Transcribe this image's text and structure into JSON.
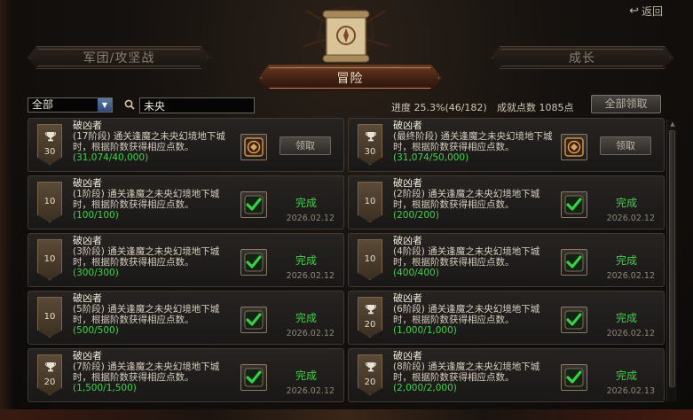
{
  "header": {
    "return_label": "返回",
    "tabs": [
      {
        "label": "军团/攻坚战"
      },
      {
        "label": "冒险"
      },
      {
        "label": "成长"
      }
    ]
  },
  "filter": {
    "selected": "全部",
    "search_value": "未央"
  },
  "summary": {
    "progress": "进度 25.3%(46/182)",
    "points": "成就点数 1085点",
    "claim_all_label": "全部领取"
  },
  "achievements": [
    {
      "title": "破凶者",
      "desc": "(17阶段) 通关逢魔之未央幻境地下城时，根据阶数获得相应点数。",
      "progress": "(31,074/40,000)",
      "points": "30",
      "cup": true,
      "status": "claim",
      "button": "领取"
    },
    {
      "title": "破凶者",
      "desc": "(最终阶段) 通关逢魔之未央幻境地下城时，根据阶数获得相应点数。",
      "progress": "(31,074/50,000)",
      "points": "30",
      "cup": true,
      "status": "claim",
      "button": "领取"
    },
    {
      "title": "破凶者",
      "desc": "(1阶段) 通关逢魔之未央幻境地下城时，根据阶数获得相应点数。",
      "progress": "(100/100)",
      "points": "10",
      "cup": false,
      "status": "done",
      "done_label": "完成",
      "date": "2026.02.12"
    },
    {
      "title": "破凶者",
      "desc": "(2阶段) 通关逢魔之未央幻境地下城时，根据阶数获得相应点数。",
      "progress": "(200/200)",
      "points": "10",
      "cup": false,
      "status": "done",
      "done_label": "完成",
      "date": "2026.02.12"
    },
    {
      "title": "破凶者",
      "desc": "(3阶段) 通关逢魔之未央幻境地下城时，根据阶数获得相应点数。",
      "progress": "(300/300)",
      "points": "10",
      "cup": false,
      "status": "done",
      "done_label": "完成",
      "date": "2026.02.12"
    },
    {
      "title": "破凶者",
      "desc": "(4阶段) 通关逢魔之未央幻境地下城时，根据阶数获得相应点数。",
      "progress": "(400/400)",
      "points": "10",
      "cup": false,
      "status": "done",
      "done_label": "完成",
      "date": "2026.02.12"
    },
    {
      "title": "破凶者",
      "desc": "(5阶段) 通关逢魔之未央幻境地下城时，根据阶数获得相应点数。",
      "progress": "(500/500)",
      "points": "10",
      "cup": false,
      "status": "done",
      "done_label": "完成",
      "date": "2026.02.12"
    },
    {
      "title": "破凶者",
      "desc": "(6阶段) 通关逢魔之未央幻境地下城时，根据阶数获得相应点数。",
      "progress": "(1,000/1,000)",
      "points": "20",
      "cup": true,
      "status": "done",
      "done_label": "完成",
      "date": "2026.02.12"
    },
    {
      "title": "破凶者",
      "desc": "(7阶段) 通关逢魔之未央幻境地下城时，根据阶数获得相应点数。",
      "progress": "(1,500/1,500)",
      "points": "20",
      "cup": true,
      "status": "done",
      "done_label": "完成",
      "date": "2026.02.12"
    },
    {
      "title": "破凶者",
      "desc": "(8阶段) 通关逢魔之未央幻境地下城时，根据阶数获得相应点数。",
      "progress": "(2,000/2,000)",
      "points": "20",
      "cup": true,
      "status": "done",
      "done_label": "完成",
      "date": "2026.02.13"
    }
  ],
  "icons": {
    "return": "return-arrow-icon",
    "search": "magnifier-icon",
    "trophy": "trophy-icon",
    "reward_chest": "reward-emblem-icon",
    "check": "checkmark-icon",
    "scroll": "scroll-emblem-icon"
  },
  "colors": {
    "complete_green": "#43cf4a",
    "progress_green": "#3fd34a",
    "banner_active": "#5a2e1a"
  }
}
